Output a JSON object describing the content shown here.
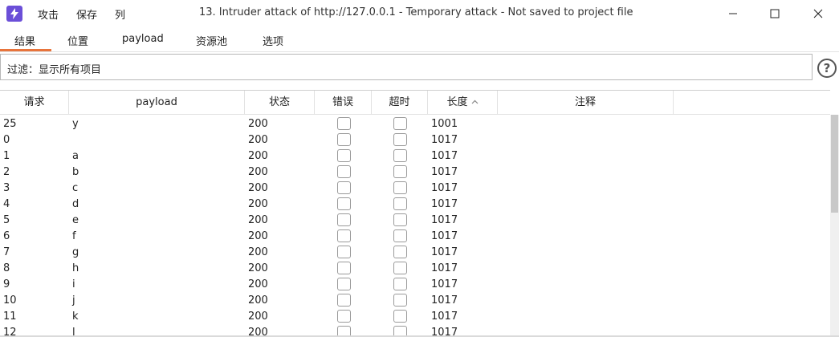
{
  "titlebar": {
    "menu": [
      "攻击",
      "保存",
      "列"
    ],
    "title": "13. Intruder attack of http://127.0.0.1 - Temporary attack - Not saved to project file"
  },
  "tabs": [
    "结果",
    "位置",
    "payload",
    "资源池",
    "选项"
  ],
  "active_tab": "结果",
  "filter": {
    "label": "过滤：显示所有项目"
  },
  "help": {
    "glyph": "?"
  },
  "table": {
    "columns": [
      "请求",
      "payload",
      "状态",
      "错误",
      "超时",
      "长度",
      "注释"
    ],
    "sort_column": "长度",
    "sort_direction": "ascending",
    "rows": [
      {
        "req": "25",
        "payload": "y",
        "status": "200",
        "length": "1001"
      },
      {
        "req": "0",
        "payload": "",
        "status": "200",
        "length": "1017"
      },
      {
        "req": "1",
        "payload": "a",
        "status": "200",
        "length": "1017"
      },
      {
        "req": "2",
        "payload": "b",
        "status": "200",
        "length": "1017"
      },
      {
        "req": "3",
        "payload": "c",
        "status": "200",
        "length": "1017"
      },
      {
        "req": "4",
        "payload": "d",
        "status": "200",
        "length": "1017"
      },
      {
        "req": "5",
        "payload": "e",
        "status": "200",
        "length": "1017"
      },
      {
        "req": "6",
        "payload": "f",
        "status": "200",
        "length": "1017"
      },
      {
        "req": "7",
        "payload": "g",
        "status": "200",
        "length": "1017"
      },
      {
        "req": "8",
        "payload": "h",
        "status": "200",
        "length": "1017"
      },
      {
        "req": "9",
        "payload": "i",
        "status": "200",
        "length": "1017"
      },
      {
        "req": "10",
        "payload": "j",
        "status": "200",
        "length": "1017"
      },
      {
        "req": "11",
        "payload": "k",
        "status": "200",
        "length": "1017"
      },
      {
        "req": "12",
        "payload": "l",
        "status": "200",
        "length": "1017"
      }
    ]
  },
  "colors": {
    "accent": "#e8743b",
    "app_icon": "#6b4fd8"
  }
}
